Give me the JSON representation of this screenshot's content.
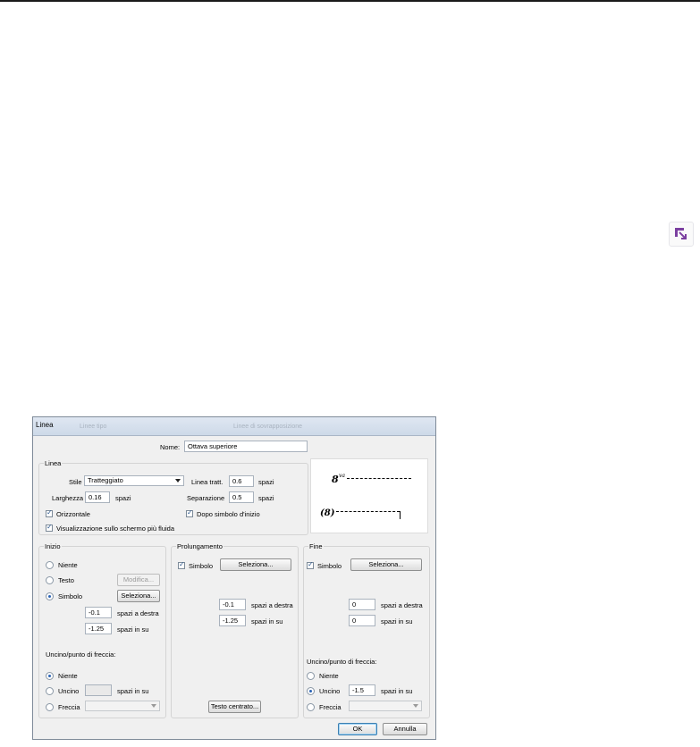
{
  "background_icon": {
    "name": "insert-dialog-icon",
    "color": "#7b3fa0"
  },
  "dialog": {
    "title": "Linea",
    "ghost_tabs": [
      "Linee tipo",
      "Linee di sovrapposizione"
    ],
    "name_label": "Nome:",
    "name_value": "Ottava superiore",
    "linea": {
      "legend": "Linea",
      "stile_label": "Stile",
      "stile_value": "Tratteggiato",
      "linea_tratt_label": "Linea tratt.",
      "linea_tratt_value": "0.6",
      "linea_tratt_unit": "spazi",
      "larghezza_label": "Larghezza",
      "larghezza_value": "0.16",
      "larghezza_unit": "spazi",
      "separazione_label": "Separazione",
      "separazione_value": "0.5",
      "separazione_unit": "spazi",
      "orizzontale_label": "Orizzontale",
      "orizzontale_checked": true,
      "dopo_simbolo_label": "Dopo simbolo d'inizio",
      "dopo_simbolo_checked": true,
      "visualizzazione_label": "Visualizzazione sullo schermo più fluida",
      "visualizzazione_checked": true
    },
    "preview": {
      "top_symbol": "8",
      "top_sup": "va",
      "bottom_symbol": "(8)"
    },
    "inizio": {
      "legend": "Inizio",
      "niente_label": "Niente",
      "testo_label": "Testo",
      "modifica_label": "Modifica...",
      "simbolo_label": "Simbolo",
      "seleziona_label": "Seleziona...",
      "selected": "Simbolo",
      "destra_value": "-0.1",
      "destra_label": "spazi a destra",
      "su_value": "-1.25",
      "su_label": "spazi in su",
      "uncino_legend": "Uncino/punto di freccia:",
      "hook_niente_label": "Niente",
      "hook_uncino_label": "Uncino",
      "hook_uncino_value": "",
      "hook_uncino_unit": "spazi in su",
      "hook_freccia_label": "Freccia",
      "hook_selected": "Niente"
    },
    "prolungamento": {
      "legend": "Prolungamento",
      "simbolo_label": "Simbolo",
      "simbolo_checked": true,
      "seleziona_label": "Seleziona...",
      "destra_value": "-0.1",
      "destra_label": "spazi a destra",
      "su_value": "-1.25",
      "su_label": "spazi in su",
      "testo_centrato_label": "Testo centrato..."
    },
    "fine": {
      "legend": "Fine",
      "simbolo_label": "Simbolo",
      "simbolo_checked": true,
      "seleziona_label": "Seleziona...",
      "destra_value": "0",
      "destra_label": "spazi a destra",
      "su_value": "0",
      "su_label": "spazi in su",
      "uncino_legend": "Uncino/punto di freccia:",
      "hook_niente_label": "Niente",
      "hook_uncino_label": "Uncino",
      "hook_uncino_value": "-1.5",
      "hook_uncino_unit": "spazi in su",
      "hook_freccia_label": "Freccia",
      "hook_selected": "Uncino"
    },
    "ok_label": "OK",
    "annulla_label": "Annulla"
  }
}
